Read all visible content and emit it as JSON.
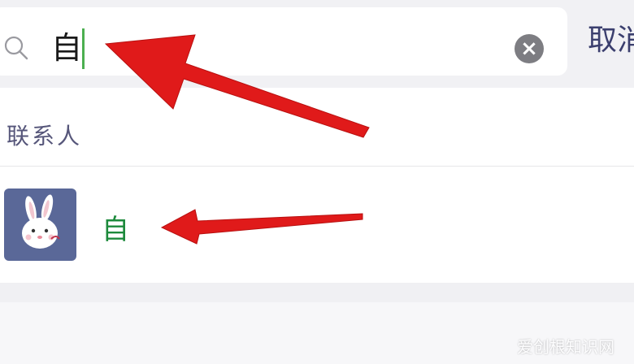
{
  "search": {
    "query": "自",
    "icons": {
      "search": "magnifier-icon",
      "clear": "clear-x-icon"
    }
  },
  "cancel_label": "取消",
  "section": {
    "title": "联系人"
  },
  "contact": {
    "name": "自",
    "avatar_icon": "rabbit-avatar"
  },
  "watermark": "爱创根知识网",
  "colors": {
    "accent_green": "#1d8a3c",
    "annotation_red": "#e01a1a",
    "avatar_bg": "#5a6898"
  }
}
